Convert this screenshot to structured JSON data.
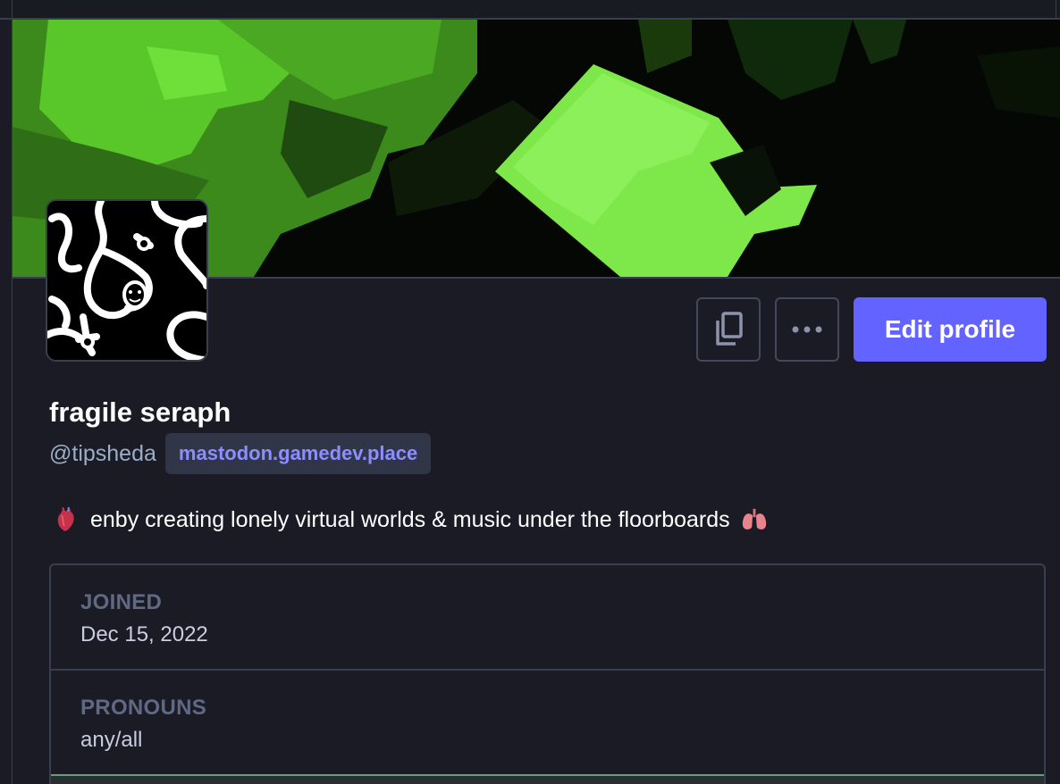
{
  "profile": {
    "display_name": "fragile seraph",
    "handle": "@tipsheda",
    "domain": "mastodon.gamedev.place",
    "bio": "enby creating lonely virtual worlds & music under the floorboards",
    "bio_emoji_left": "anatomical-heart",
    "bio_emoji_right": "lungs"
  },
  "actions": {
    "copy_icon": "copy-icon",
    "more_icon": "ellipsis-icon",
    "edit_label": "Edit profile"
  },
  "fields": [
    {
      "label": "JOINED",
      "value": "Dec 15, 2022"
    },
    {
      "label": "PRONOUNS",
      "value": "any/all"
    }
  ],
  "colors": {
    "accent": "#6364ff",
    "background": "#1b1b25",
    "banner_green": "#6ee23a",
    "domain_text": "#8c8dff"
  }
}
